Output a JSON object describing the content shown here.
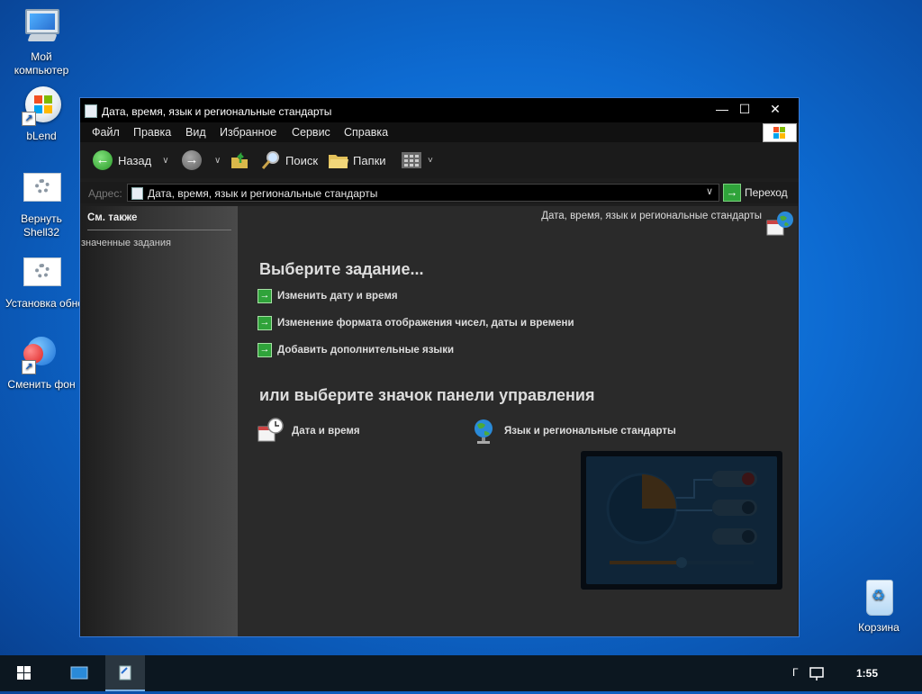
{
  "desktop": {
    "icons": [
      {
        "label": "Мой компьютер"
      },
      {
        "label": "bLend"
      },
      {
        "label": "Вернуть Shell32"
      },
      {
        "label": "Установка обновлен..."
      },
      {
        "label": "Сменить фон"
      },
      {
        "label": "Корзина"
      }
    ]
  },
  "window": {
    "title": "Дата, время, язык и региональные стандарты",
    "controls": {
      "minimize": "—",
      "maximize": "☐",
      "close": "✕"
    },
    "menu": [
      "Файл",
      "Правка",
      "Вид",
      "Избранное",
      "Сервис",
      "Справка"
    ],
    "toolbar": {
      "back": "Назад",
      "search": "Поиск",
      "folders": "Папки"
    },
    "address": {
      "label": "Адрес:",
      "value": "Дата, время, язык и региональные стандарты",
      "go": "Переход"
    },
    "left_pane": {
      "header": "См. также",
      "item": "значенные задания"
    },
    "content": {
      "breadcrumb": "Дата, время, язык и региональные стандарты",
      "pick_task": "Выберите задание...",
      "tasks": [
        "Изменить дату и время",
        "Изменение формата отображения чисел, даты и времени",
        "Добавить дополнительные языки"
      ],
      "or_pick_icon": "или выберите значок панели управления",
      "control_panel_icons": [
        "Дата и время",
        "Язык и региональные стандарты"
      ]
    }
  },
  "taskbar": {
    "clock": "1:55",
    "tray_text": "Г"
  },
  "colors": {
    "desktop_blue": "#0d6bd2",
    "window_bg": "#2a2a2a",
    "task_green": "#2fa33a",
    "taskbar": "#0c1720"
  }
}
